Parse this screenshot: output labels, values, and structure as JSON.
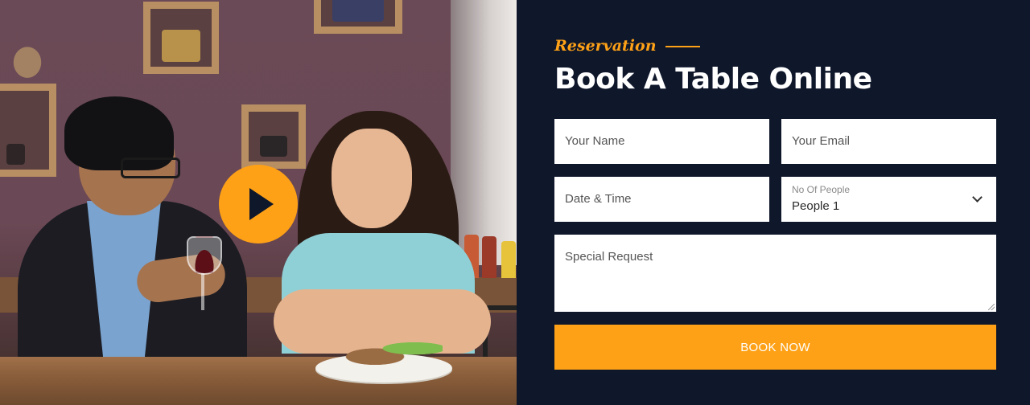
{
  "video_panel": {
    "play_icon": "play-icon"
  },
  "booking": {
    "kicker": "Reservation",
    "title": "Book A Table Online",
    "fields": {
      "name": {
        "placeholder": "Your Name"
      },
      "email": {
        "placeholder": "Your Email"
      },
      "datetime": {
        "placeholder": "Date & Time"
      },
      "people": {
        "label": "No Of People",
        "value": "People 1",
        "icon": "chevron-down-icon"
      },
      "request": {
        "placeholder": "Special Request"
      }
    },
    "submit_label": "BOOK NOW"
  },
  "colors": {
    "accent": "#fea116",
    "panel_background": "#0f172b",
    "field_background": "#ffffff"
  }
}
